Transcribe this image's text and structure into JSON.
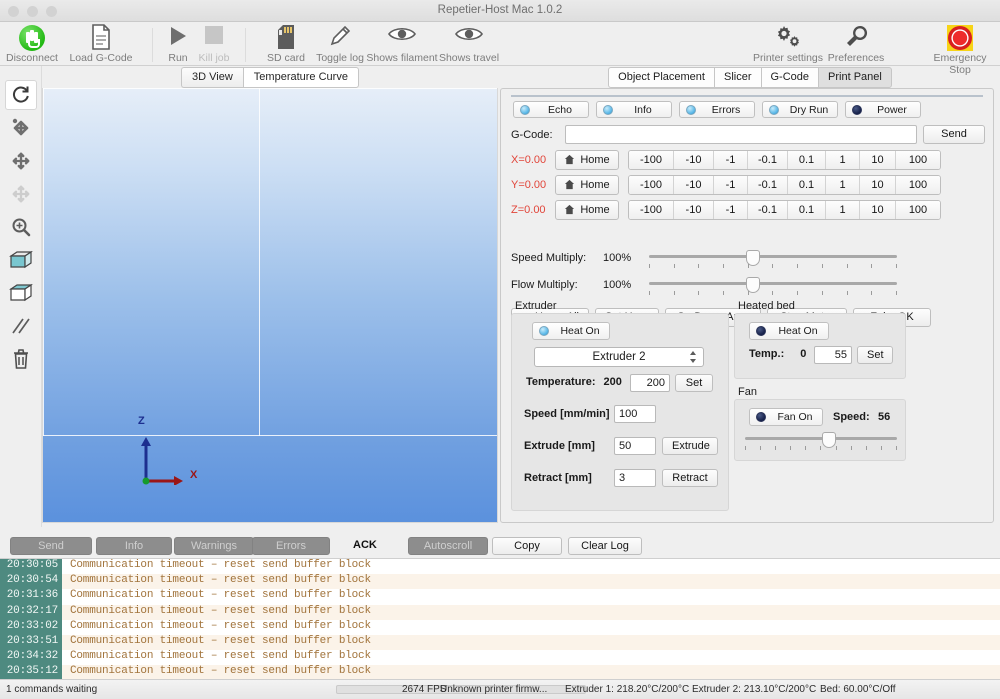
{
  "window": {
    "title": "Repetier-Host Mac 1.0.2"
  },
  "toolbar": {
    "items": [
      {
        "label": "Disconnect",
        "icon": "plug-icon",
        "disabled": false
      },
      {
        "label": "Load G-Code",
        "icon": "document-icon",
        "disabled": false
      },
      {
        "label": "Run",
        "icon": "play-icon",
        "disabled": false
      },
      {
        "label": "Kill job",
        "icon": "stop-square-icon",
        "disabled": true
      },
      {
        "label": "SD card",
        "icon": "sdcard-icon",
        "disabled": false
      },
      {
        "label": "Toggle log",
        "icon": "pencil-icon",
        "disabled": false
      },
      {
        "label": "Shows filament",
        "icon": "eye-icon",
        "disabled": false
      },
      {
        "label": "Shows travel",
        "icon": "eye-icon",
        "disabled": false
      },
      {
        "label": "Printer settings",
        "icon": "gears-icon",
        "disabled": false
      },
      {
        "label": "Preferences",
        "icon": "wrench-icon",
        "disabled": false
      },
      {
        "label": "Emergency Stop",
        "icon": "emergency-stop-icon",
        "disabled": false
      }
    ]
  },
  "view_tools": [
    {
      "name": "reset-view-icon",
      "selected": true,
      "disabled": false
    },
    {
      "name": "move-object-icon",
      "selected": false,
      "disabled": false
    },
    {
      "name": "move-view-icon",
      "selected": false,
      "disabled": false
    },
    {
      "name": "move-disabled-icon",
      "selected": false,
      "disabled": true
    },
    {
      "name": "zoom-icon",
      "selected": false,
      "disabled": false
    },
    {
      "name": "solid-cube-icon",
      "selected": false,
      "disabled": false
    },
    {
      "name": "wireframe-cube-icon",
      "selected": false,
      "disabled": false
    },
    {
      "name": "lines-icon",
      "selected": false,
      "disabled": false
    },
    {
      "name": "trash-icon",
      "selected": false,
      "disabled": false
    }
  ],
  "view_panel": {
    "tabs": [
      {
        "label": "3D View",
        "active": false
      },
      {
        "label": "Temperature Curve",
        "active": true
      }
    ],
    "axes": {
      "z": "Z",
      "x": "X"
    }
  },
  "right_panel": {
    "tabs": [
      {
        "label": "Object Placement",
        "active": false
      },
      {
        "label": "Slicer",
        "active": false
      },
      {
        "label": "G-Code",
        "active": false
      },
      {
        "label": "Print Panel",
        "active": true
      }
    ],
    "leds": [
      {
        "label": "Echo",
        "state": "on"
      },
      {
        "label": "Info",
        "state": "on"
      },
      {
        "label": "Errors",
        "state": "on"
      },
      {
        "label": "Dry Run",
        "state": "on"
      },
      {
        "label": "Power",
        "state": "off"
      }
    ],
    "gcode": {
      "label": "G-Code:",
      "value": "",
      "placeholder": "",
      "send_label": "Send"
    },
    "axes": [
      {
        "readout": "X=0.00",
        "home_label": "Home",
        "steps": [
          "-100",
          "-10",
          "-1",
          "-0.1",
          "0.1",
          "1",
          "10",
          "100"
        ]
      },
      {
        "readout": "Y=0.00",
        "home_label": "Home",
        "steps": [
          "-100",
          "-10",
          "-1",
          "-0.1",
          "0.1",
          "1",
          "10",
          "100"
        ]
      },
      {
        "readout": "Z=0.00",
        "home_label": "Home",
        "steps": [
          "-100",
          "-10",
          "-1",
          "-0.1",
          "0.1",
          "1",
          "10",
          "100"
        ]
      }
    ],
    "home_row": [
      {
        "label": "Home All"
      },
      {
        "label": "Set Home"
      },
      {
        "label": "Go Dump Area"
      },
      {
        "label": "Stop Motor"
      },
      {
        "label": "Fake OK"
      }
    ],
    "multipliers": [
      {
        "label": "Speed Multiply:",
        "value": "100%",
        "percent": 42
      },
      {
        "label": "Flow Multiply:",
        "value": "100%",
        "percent": 42
      }
    ],
    "extruder": {
      "title": "Extruder",
      "heat_label": "Heat On",
      "heat_state": "on",
      "selected_extruder": "Extruder 2",
      "temperature_label": "Temperature:",
      "temperature_current": "200",
      "temperature_target": "200",
      "set_label": "Set",
      "speed_label": "Speed [mm/min]",
      "speed_value": "100",
      "extrude_label": "Extrude [mm]",
      "extrude_value": "50",
      "extrude_button": "Extrude",
      "retract_label": "Retract [mm]",
      "retract_value": "3",
      "retract_button": "Retract"
    },
    "heated_bed": {
      "title": "Heated bed",
      "heat_label": "Heat On",
      "heat_state": "off",
      "temp_label": "Temp.:",
      "temp_current": "0",
      "temp_target": "55",
      "set_label": "Set"
    },
    "fan": {
      "title": "Fan",
      "fan_label": "Fan On",
      "fan_state": "off",
      "speed_label": "Speed:",
      "speed_value": "56",
      "percent": 55
    }
  },
  "log_toolbar": {
    "buttons": [
      {
        "label": "Send",
        "toggled": true
      },
      {
        "label": "Info",
        "toggled": true
      },
      {
        "label": "Warnings",
        "toggled": true
      },
      {
        "label": "Errors",
        "toggled": true
      },
      {
        "label": "Autoscroll",
        "toggled": true
      },
      {
        "label": "Copy",
        "toggled": false
      },
      {
        "label": "Clear Log",
        "toggled": false
      }
    ],
    "ack_label": "ACK"
  },
  "log": {
    "lines": [
      {
        "time": "20:30:05",
        "message": "Communication timeout – reset send buffer block"
      },
      {
        "time": "20:30:54",
        "message": "Communication timeout – reset send buffer block"
      },
      {
        "time": "20:31:36",
        "message": "Communication timeout – reset send buffer block"
      },
      {
        "time": "20:32:17",
        "message": "Communication timeout – reset send buffer block"
      },
      {
        "time": "20:33:02",
        "message": "Communication timeout – reset send buffer block"
      },
      {
        "time": "20:33:51",
        "message": "Communication timeout – reset send buffer block"
      },
      {
        "time": "20:34:32",
        "message": "Communication timeout – reset send buffer block"
      },
      {
        "time": "20:35:12",
        "message": "Communication timeout – reset send buffer block"
      }
    ]
  },
  "statusbar": {
    "commands": "1 commands waiting",
    "fps": "2674 FPS",
    "firmware": "Unknown printer firmw...",
    "extruder1": "Extruder 1: 218.20°C/200°C",
    "extruder2": "Extruder 2: 213.10°C/200°C",
    "bed": "Bed: 60.00°C/Off"
  },
  "colors": {
    "accent_red": "#e1453a",
    "led_on": "#5ab8e8",
    "led_off": "#16204a",
    "log_ts_bg": "#4e8a80",
    "log_text": "#a2743c",
    "connect_green": "#23b914"
  }
}
